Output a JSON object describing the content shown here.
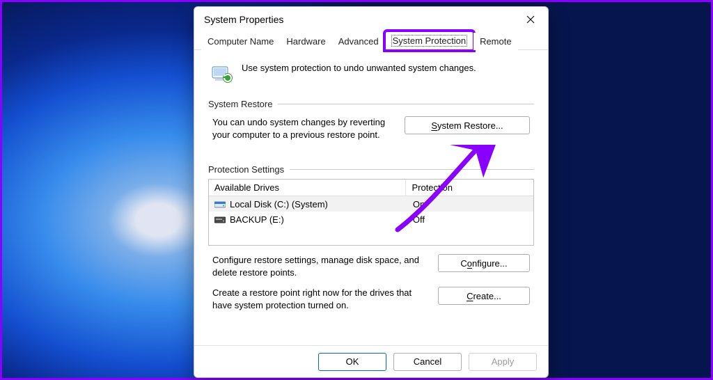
{
  "window": {
    "title": "System Properties",
    "tabs": [
      "Computer Name",
      "Hardware",
      "Advanced",
      "System Protection",
      "Remote"
    ],
    "active_tab_index": 3
  },
  "intro_text": "Use system protection to undo unwanted system changes.",
  "restore": {
    "section_title": "System Restore",
    "description": "You can undo system changes by reverting your computer to a previous restore point.",
    "button_label": "System Restore..."
  },
  "protection": {
    "section_title": "Protection Settings",
    "columns": {
      "drives": "Available Drives",
      "protection": "Protection"
    },
    "rows": [
      {
        "icon": "system-drive",
        "name": "Local Disk (C:) (System)",
        "protection": "On",
        "selected": true
      },
      {
        "icon": "drive",
        "name": "BACKUP (E:)",
        "protection": "Off",
        "selected": false
      }
    ],
    "configure_text": "Configure restore settings, manage disk space, and delete restore points.",
    "configure_button": "Configure...",
    "create_text": "Create a restore point right now for the drives that have system protection turned on.",
    "create_button": "Create..."
  },
  "footer": {
    "ok": "OK",
    "cancel": "Cancel",
    "apply": "Apply"
  },
  "annotation": {
    "color": "#8a00ff"
  }
}
